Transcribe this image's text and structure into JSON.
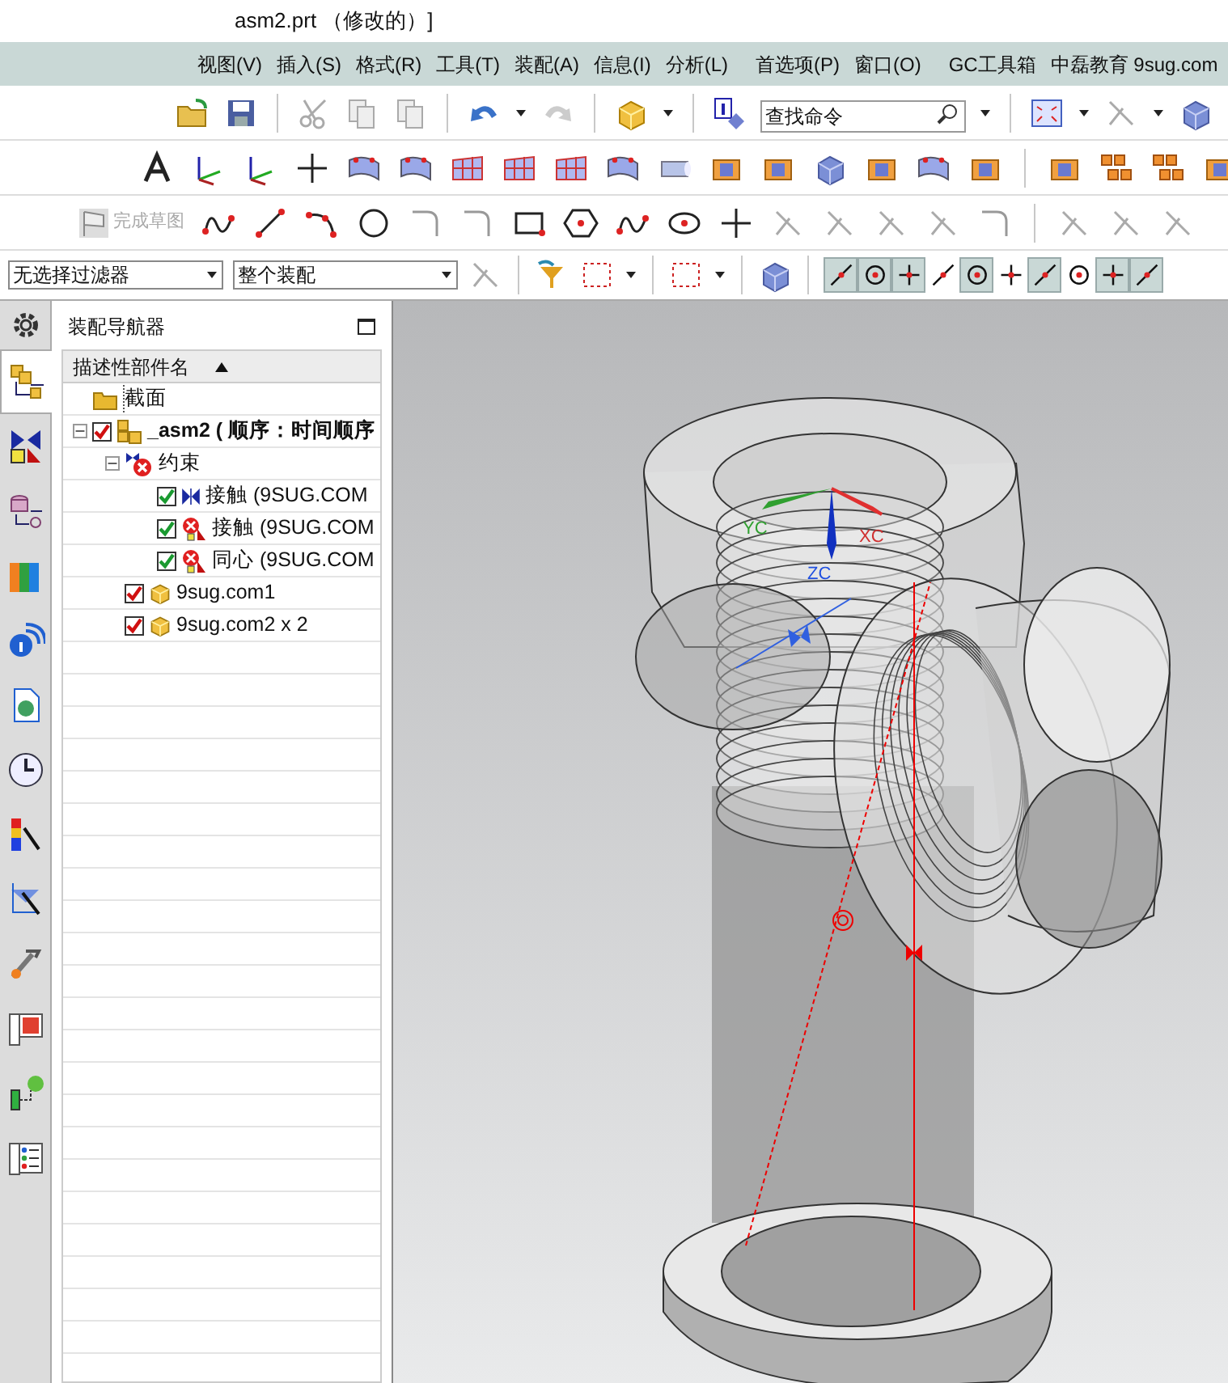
{
  "window": {
    "title": "asm2.prt （修改的）]"
  },
  "menu": [
    "视图(V)",
    "插入(S)",
    "格式(R)",
    "工具(T)",
    "装配(A)",
    "信息(I)",
    "分析(L)",
    "首选项(P)",
    "窗口(O)",
    "GC工具箱",
    "中磊教育 9sug.com"
  ],
  "toolbar": {
    "search": {
      "placeholder": "查找命令"
    },
    "finish_sketch": {
      "label": "完成草图",
      "disabled": true
    },
    "selection_filter": {
      "value": "无选择过滤器"
    },
    "assembly_scope": {
      "value": "整个装配"
    },
    "snap_buttons": [
      {
        "selected": true
      },
      {
        "selected": true
      },
      {
        "selected": true
      },
      {
        "selected": false
      },
      {
        "selected": true
      },
      {
        "selected": false
      },
      {
        "selected": true
      },
      {
        "selected": false
      },
      {
        "selected": true
      },
      {
        "selected": true
      }
    ]
  },
  "resource_tabs": [
    {
      "selected": false
    },
    {
      "selected": true
    },
    {
      "selected": false
    },
    {
      "selected": false
    },
    {
      "selected": false
    },
    {
      "selected": false
    },
    {
      "selected": false
    },
    {
      "selected": false
    },
    {
      "selected": false
    },
    {
      "selected": false
    },
    {
      "selected": false
    },
    {
      "selected": false
    },
    {
      "selected": false
    },
    {
      "selected": false
    }
  ],
  "navigator": {
    "title": "装配导航器",
    "column": {
      "label": "描述性部件名",
      "sort_ascending": true
    },
    "tree": [
      {
        "kind": "folder",
        "label": "截面"
      },
      {
        "kind": "assembly",
        "label": "_asm2 ( 顺序：时间顺序",
        "checked": true,
        "expanded": true,
        "children": [
          {
            "kind": "constraints",
            "label": "约束",
            "expanded": true,
            "children": [
              {
                "kind": "touch",
                "label": "接触 (9SUG.COM",
                "checked": true
              },
              {
                "kind": "touch_error",
                "label": "接触 (9SUG.COM",
                "checked": true
              },
              {
                "kind": "concentric_error",
                "label": "同心 (9SUG.COM",
                "checked": true
              }
            ]
          },
          {
            "kind": "part",
            "label": "9sug.com1",
            "checked": true
          },
          {
            "kind": "part",
            "label": "9sug.com2 x 2",
            "checked": true
          }
        ]
      }
    ]
  },
  "viewport": {
    "axes": [
      "YC",
      "XC",
      "ZC"
    ]
  }
}
